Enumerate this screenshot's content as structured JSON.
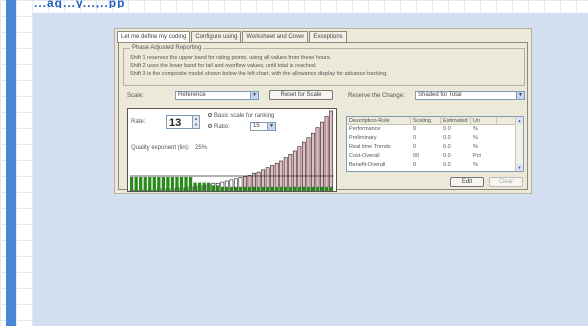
{
  "header": {
    "text": "...ag...y...,..pp"
  },
  "dialog": {
    "tabs": [
      {
        "label": "Let me define my coding",
        "active": true
      },
      {
        "label": "Configure using",
        "active": false
      },
      {
        "label": "Worksheet and Cover",
        "active": false
      },
      {
        "label": "Exceptions",
        "active": false
      }
    ],
    "group": {
      "legend": "Phase Adjusted Reporting",
      "lines": [
        "Shift 1 reserves the upper band for rating points, using all values from these hours.",
        "Shift 2 uses the lower band for tail and overflow values, until total is reached.",
        "Shift 3 is the composite model shown below the left chart, with the allowance display for advance tracking."
      ]
    },
    "scale": {
      "label": "Scale:",
      "value": "Reference",
      "button": "Reset for Scale"
    },
    "shapes": {
      "label": "Reserve the Change:",
      "value": "Shaded for Total"
    },
    "preview": {
      "field_label": "Rate:",
      "spin_value": "13",
      "option1": "Basic scale for ranking",
      "option2_label": "Ratio:",
      "option2_value": "15",
      "footer": "Quality exponent (lin):",
      "footer_value": "25%"
    },
    "list": {
      "headers": [
        "Description-Rule",
        "Scaling",
        "Estimated",
        "Un"
      ],
      "rows": [
        [
          "Performance",
          "0",
          "0.0",
          "%"
        ],
        [
          "Preliminary",
          "0",
          "0.0",
          "%"
        ],
        [
          "Real time Trends",
          "0",
          "0.0",
          "%"
        ],
        [
          "Cost-Overall",
          "00",
          "0.0",
          "Pct"
        ],
        [
          "Benefit-Overall",
          "0",
          "0.0",
          "%"
        ]
      ]
    },
    "buttons": {
      "edit": "Edit",
      "clear": "Clear"
    }
  },
  "chart_data": {
    "type": "bar",
    "values": [
      1,
      1,
      1,
      1,
      1,
      1,
      2,
      2,
      2,
      2,
      3,
      3,
      3,
      4,
      4,
      5,
      5,
      6,
      7,
      7,
      8,
      9,
      10,
      11,
      12,
      13,
      14,
      16,
      17,
      19,
      21,
      23,
      25,
      27,
      30,
      33,
      36,
      40,
      44,
      48,
      52,
      57,
      62,
      67,
      72
    ],
    "fill_colors": [
      "#ffffff",
      "#e8bcc0"
    ],
    "level_band_values": [
      1,
      1,
      1,
      1,
      1,
      1,
      1,
      1,
      1,
      1,
      1,
      1,
      1,
      1,
      0.6,
      0.6,
      0.6,
      0.6,
      0.4,
      0.4,
      0.3,
      0.3,
      0.3,
      0.3,
      0.3,
      0.3,
      0.3,
      0.3,
      0.3,
      0.3,
      0.3,
      0.3,
      0.3,
      0.3,
      0.3,
      0.3,
      0.3,
      0.3,
      0.3,
      0.3,
      0.3,
      0.3,
      0.3,
      0.3,
      0.3
    ],
    "level_band_color": "#2a8a1a"
  }
}
